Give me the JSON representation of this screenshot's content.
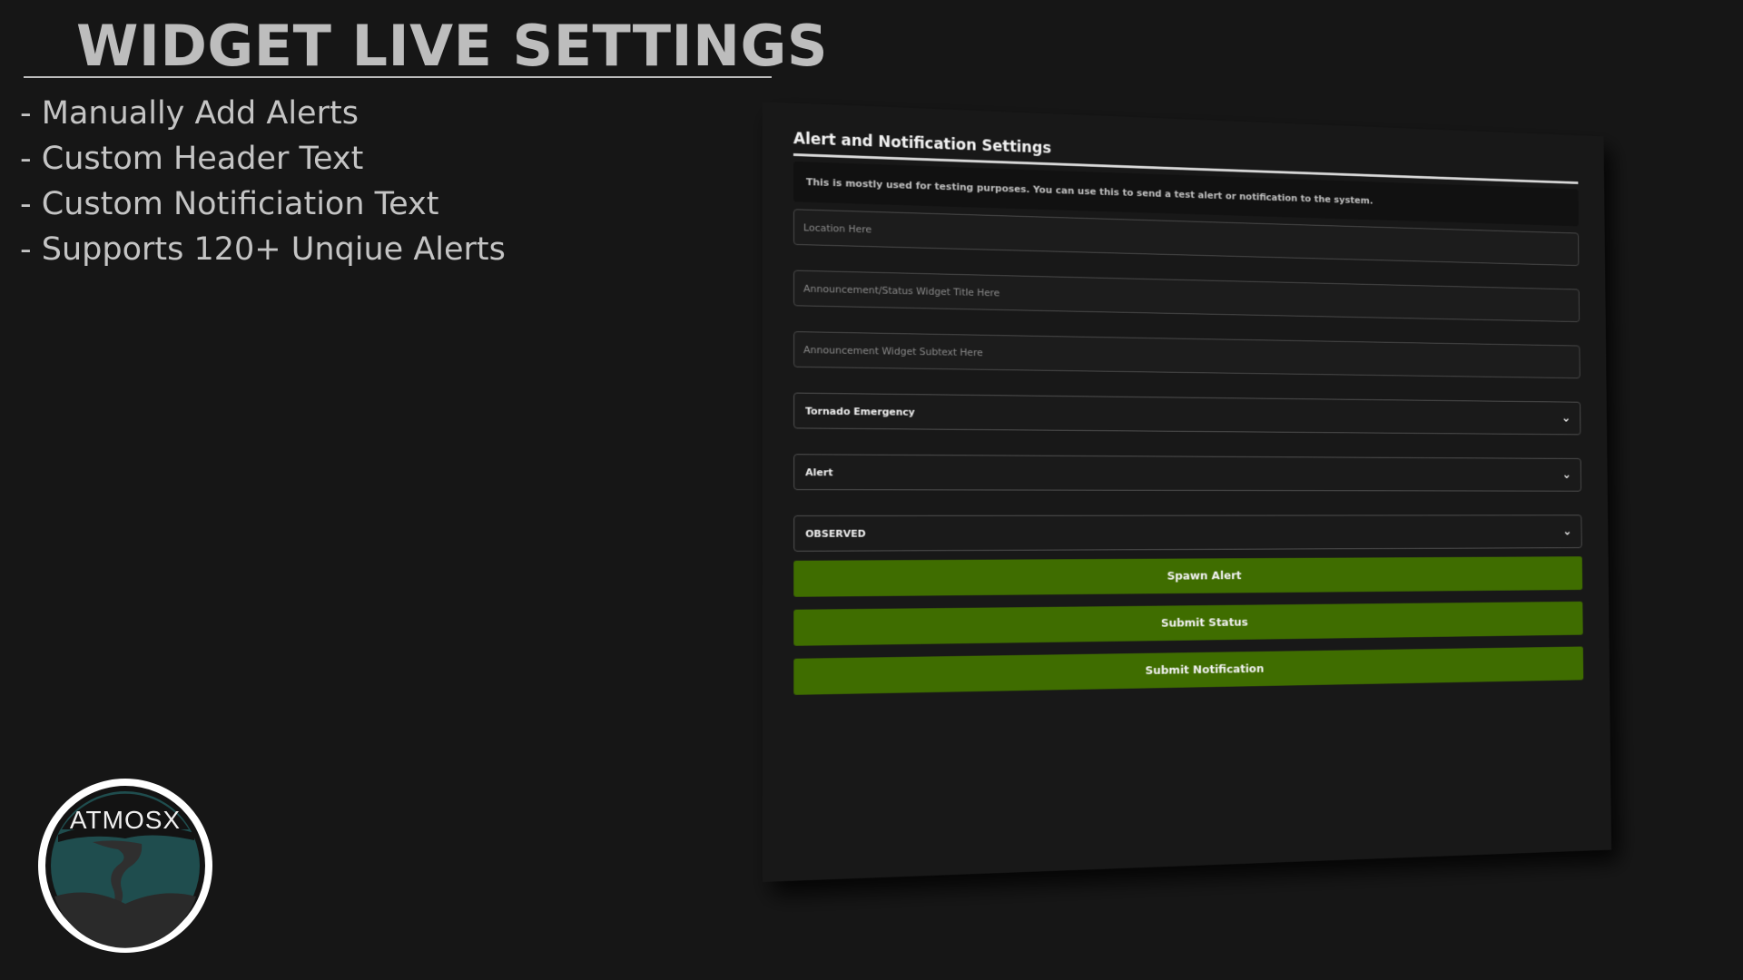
{
  "promo": {
    "title": "WIDGET LIVE SETTINGS",
    "features": [
      "- Manually Add Alerts",
      "- Custom Header Text",
      "- Custom Notificiation Text",
      "- Supports 120+ Unqiue Alerts"
    ]
  },
  "logo": {
    "text": "ATMOSX"
  },
  "settings": {
    "title": "Alert and Notification Settings",
    "description": "This is mostly used for testing purposes. You can use this to send a test alert or notification to the system.",
    "location_placeholder": "Location Here",
    "title_placeholder": "Announcement/Status Widget Title Here",
    "subtext_placeholder": "Announcement Widget Subtext Here",
    "alert_type_value": "Tornado Emergency",
    "category_value": "Alert",
    "certainty_value": "OBSERVED",
    "spawn_button": "Spawn Alert",
    "status_button": "Submit Status",
    "notification_button": "Submit Notification"
  },
  "colors": {
    "background": "#161616",
    "panel": "#181818",
    "button_green": "#3f6d00",
    "logo_teal": "#1f4d4e"
  },
  "icons": {
    "select_chevron": "chevron-down-icon",
    "logo": "tornado-icon"
  }
}
